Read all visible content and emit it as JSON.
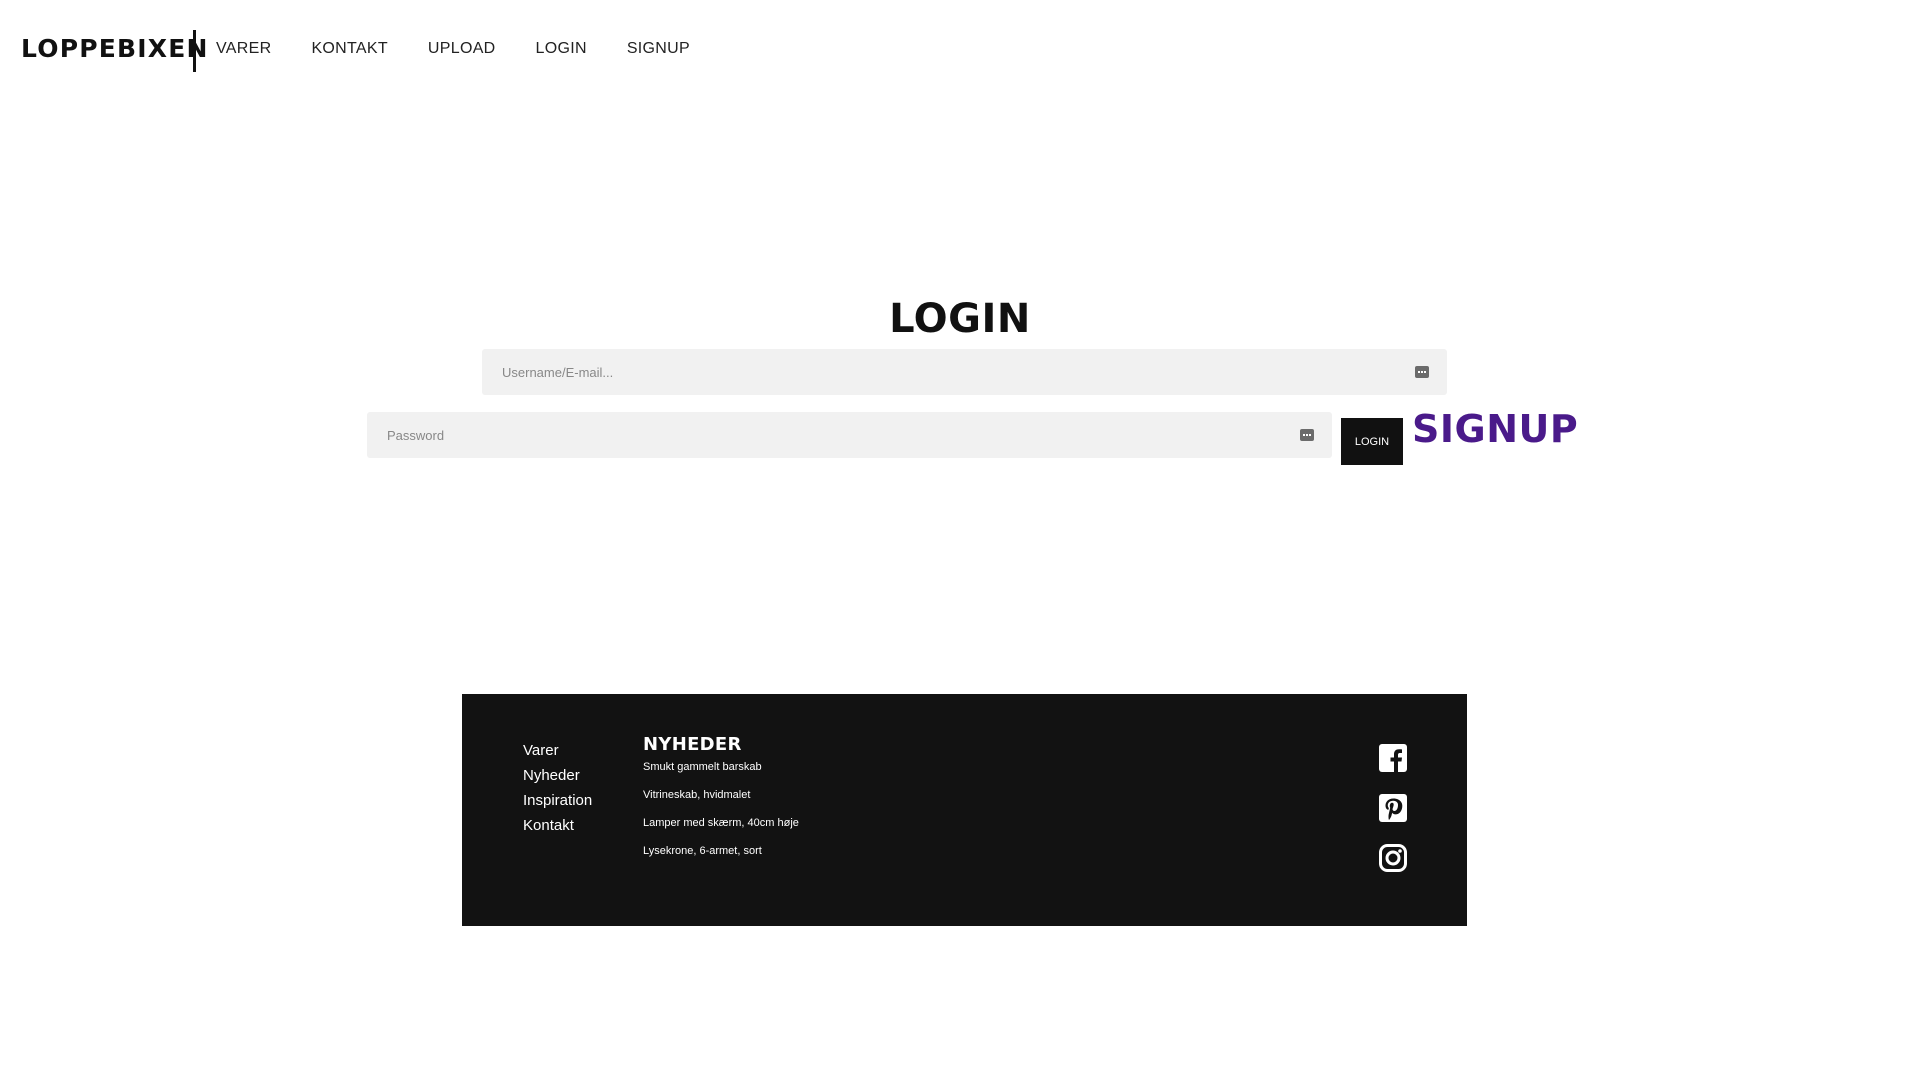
{
  "header": {
    "logo": "LOPPEBIXEN",
    "nav": [
      "VARER",
      "KONTAKT",
      "UPLOAD",
      "LOGIN",
      "SIGNUP"
    ]
  },
  "main": {
    "title": "LOGIN",
    "username_placeholder": "Username/E-mail...",
    "password_placeholder": "Password",
    "login_button": "LOGIN",
    "signup_link": "SIGNUP",
    "field_icon": "password-manager-icon",
    "signup_color": "#4a1a8a"
  },
  "footer": {
    "nav": [
      "Varer",
      "Nyheder",
      "Inspiration",
      "Kontakt"
    ],
    "news_title": "NYHEDER",
    "news_items": [
      "Smukt gammelt barskab",
      "Vitrineskab, hvidmalet",
      "Lamper med skærm, 40cm høje",
      "Lysekrone, 6-armet, sort"
    ],
    "social": [
      "facebook-icon",
      "pinterest-icon",
      "instagram-icon"
    ],
    "background": "#121212"
  }
}
